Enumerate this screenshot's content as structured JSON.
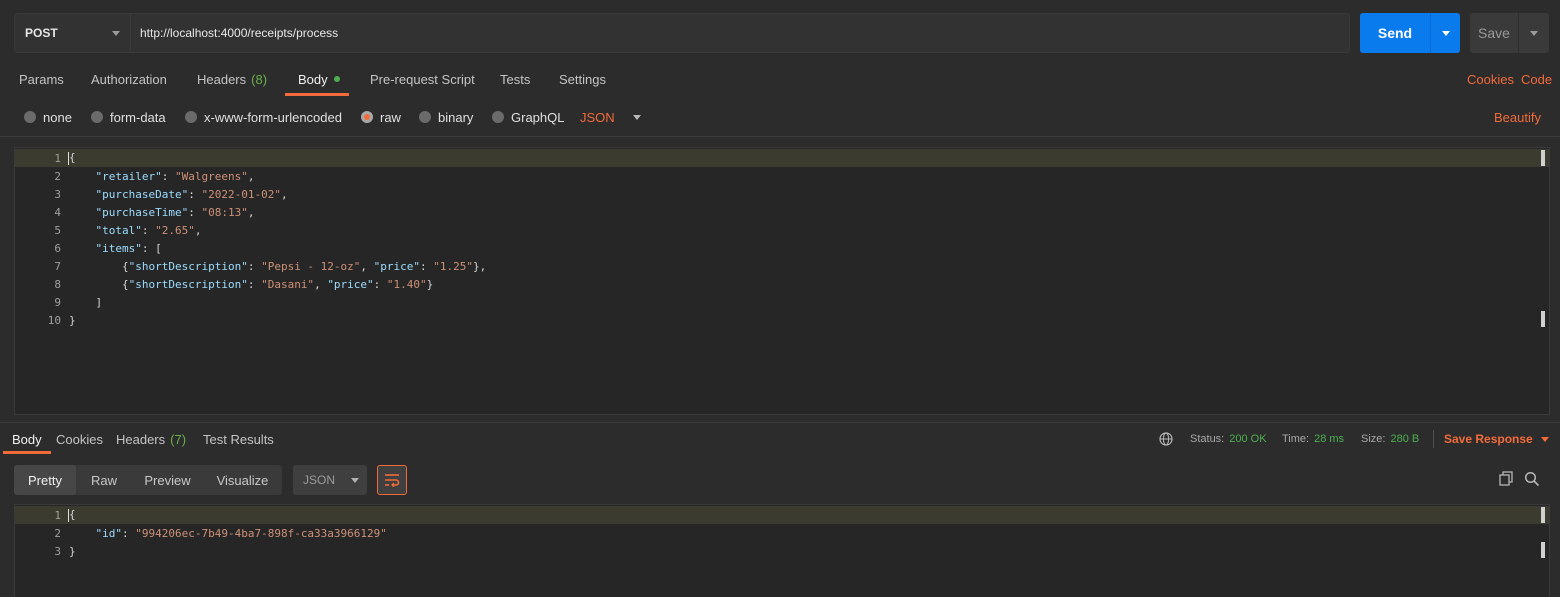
{
  "request": {
    "method": "POST",
    "url": "http://localhost:4000/receipts/process",
    "send_label": "Send",
    "save_label": "Save"
  },
  "tabs": {
    "params": "Params",
    "authorization": "Authorization",
    "headers": "Headers",
    "headers_count": "(8)",
    "body": "Body",
    "prerequest": "Pre-request Script",
    "tests": "Tests",
    "settings": "Settings",
    "cookies": "Cookies",
    "code": "Code"
  },
  "body_types": {
    "none": "none",
    "form_data": "form-data",
    "urlencoded": "x-www-form-urlencoded",
    "raw": "raw",
    "binary": "binary",
    "graphql": "GraphQL",
    "format": "JSON",
    "beautify": "Beautify"
  },
  "request_body": {
    "line_numbers": [
      "1",
      "2",
      "3",
      "4",
      "5",
      "6",
      "7",
      "8",
      "9",
      "10"
    ],
    "retailer_key": "\"retailer\"",
    "retailer_val": "\"Walgreens\"",
    "date_key": "\"purchaseDate\"",
    "date_val": "\"2022-01-02\"",
    "time_key": "\"purchaseTime\"",
    "time_val": "\"08:13\"",
    "total_key": "\"total\"",
    "total_val": "\"2.65\"",
    "items_key": "\"items\"",
    "desc_key": "\"shortDescription\"",
    "price_key": "\"price\"",
    "item1_desc": "\"Pepsi - 12-oz\"",
    "item1_price": "\"1.25\"",
    "item2_desc": "\"Dasani\"",
    "item2_price": "\"1.40\""
  },
  "response": {
    "tabs": {
      "body": "Body",
      "cookies": "Cookies",
      "headers": "Headers",
      "headers_count": "(7)",
      "test_results": "Test Results"
    },
    "status_label": "Status:",
    "status_value": "200 OK",
    "time_label": "Time:",
    "time_value": "28 ms",
    "size_label": "Size:",
    "size_value": "280 B",
    "save_response": "Save Response",
    "view_modes": {
      "pretty": "Pretty",
      "raw": "Raw",
      "preview": "Preview",
      "visualize": "Visualize"
    },
    "format": "JSON",
    "line_numbers": [
      "1",
      "2",
      "3"
    ],
    "id_key": "\"id\"",
    "id_val": "\"994206ec-7b49-4ba7-898f-ca33a3966129\""
  },
  "colors": {
    "accent": "#f26b3a",
    "send": "#097bed",
    "status_ok": "#4caf50"
  }
}
